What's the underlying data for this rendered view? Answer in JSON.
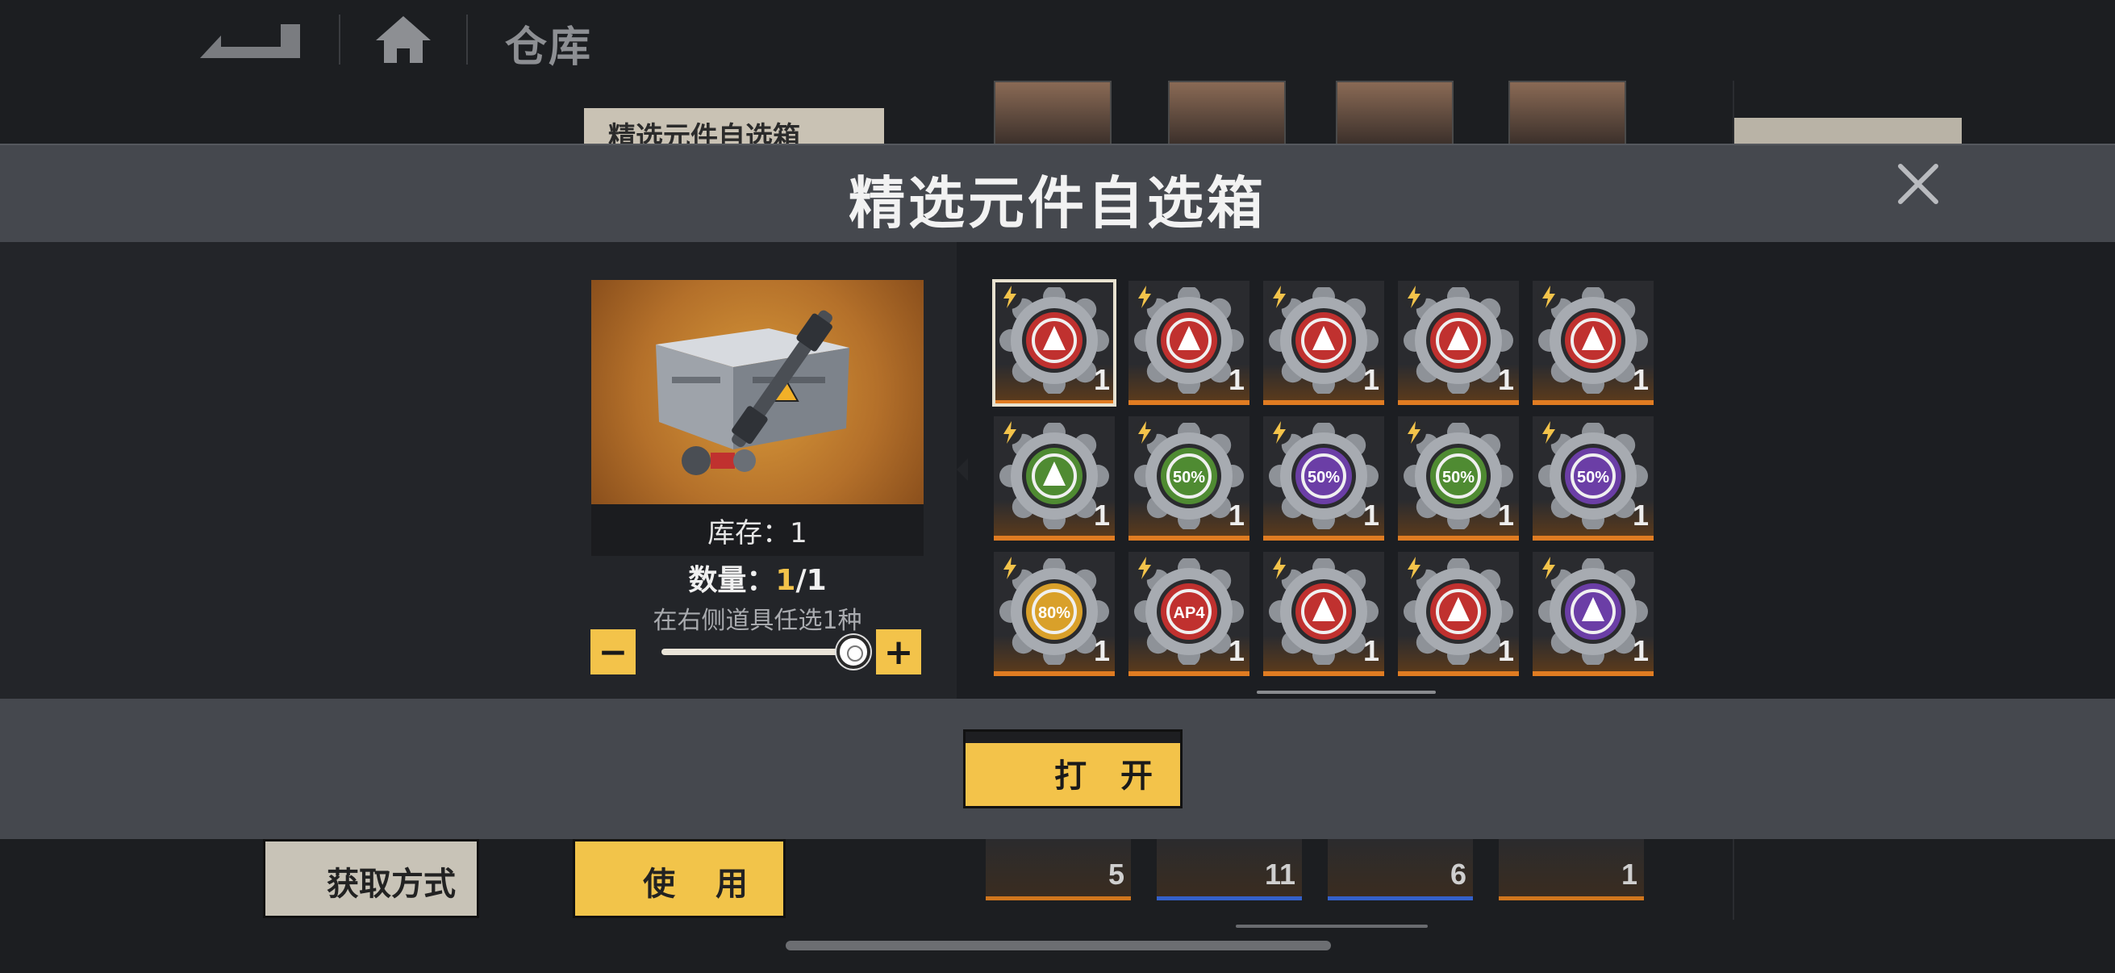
{
  "header": {
    "page_title": "仓库"
  },
  "background": {
    "tab_label": "精选元件自选箱",
    "get_method_label": "获取方式",
    "use_label": "使 用",
    "item_counts": [
      "5",
      "11",
      "6",
      "1"
    ]
  },
  "modal": {
    "title": "精选元件自选箱",
    "stock_label": "库存：1",
    "quantity_prefix": "数量：",
    "quantity_current": "1",
    "quantity_total": "/1",
    "hint": "在右侧道具任选1种",
    "minus_label": "−",
    "plus_label": "+",
    "slider_fraction": 1.0,
    "open_label": "打 开"
  },
  "items": [
    {
      "icon": "red-bird-module-icon",
      "color": "#c0312f",
      "count": "1",
      "selected": true
    },
    {
      "icon": "red-cycle-module-icon",
      "color": "#c0312f",
      "count": "1"
    },
    {
      "icon": "red-blade-module-icon",
      "color": "#c0312f",
      "count": "1"
    },
    {
      "icon": "red-shuriken-module-icon",
      "color": "#c0312f",
      "count": "1"
    },
    {
      "icon": "red-shield-burst-module-icon",
      "color": "#c0312f",
      "count": "1"
    },
    {
      "icon": "green-shield-module-icon",
      "color": "#4f8b32",
      "count": "1"
    },
    {
      "icon": "green-50-percent-module-icon",
      "color": "#4f8b32",
      "count": "1",
      "text": "50%"
    },
    {
      "icon": "purple-50-percent-module-icon",
      "color": "#6b3ea6",
      "count": "1",
      "text": "50%"
    },
    {
      "icon": "green-50-percent-swap-module-icon",
      "color": "#4f8b32",
      "count": "1",
      "text": "50%"
    },
    {
      "icon": "purple-50-percent-back-module-icon",
      "color": "#6b3ea6",
      "count": "1",
      "text": "50%"
    },
    {
      "icon": "yellow-80-percent-module-icon",
      "color": "#d9a02a",
      "count": "1",
      "text": "80%"
    },
    {
      "icon": "red-ap4-module-icon",
      "color": "#c0312f",
      "count": "1",
      "text": "AP4"
    },
    {
      "icon": "red-crosshair-module-icon",
      "color": "#c0312f",
      "count": "1"
    },
    {
      "icon": "red-target-module-icon",
      "color": "#c0312f",
      "count": "1"
    },
    {
      "icon": "purple-ring-module-icon",
      "color": "#6b3ea6",
      "count": "1"
    }
  ],
  "colors": {
    "accent": "#f3c34a",
    "rarity_orange": "#e07c22"
  }
}
